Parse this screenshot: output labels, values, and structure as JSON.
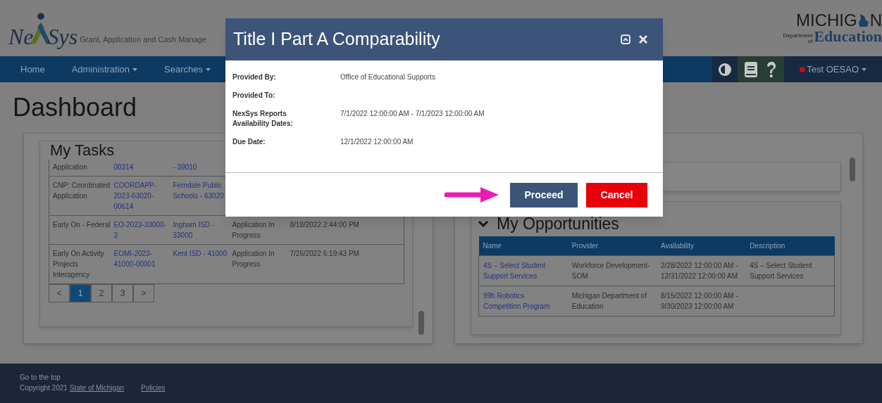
{
  "header": {
    "logo": {
      "left": "Ne",
      "right": "Sys"
    },
    "tagline": "Grant, Application and Cash Manage",
    "state_logo": {
      "top_left": "MICHIG",
      "top_right": "N",
      "small_top": "Department",
      "small_bottom": "of",
      "bottom": "Education"
    }
  },
  "nav": {
    "items": [
      {
        "label": "Home",
        "dropdown": false
      },
      {
        "label": "Administration",
        "dropdown": true
      },
      {
        "label": "Searches",
        "dropdown": true
      }
    ],
    "user": "Test OESAO"
  },
  "page_title": "Dashboard",
  "tasks": {
    "title": "My Tasks",
    "rows": [
      {
        "cells": [
          "Application",
          "00314",
          "- 39010"
        ]
      },
      {
        "cells": [
          "CNP: Coordinated Application",
          "COORDAPP-2023-63020-00614",
          "Ferndale Public Schools - 63020"
        ]
      },
      {
        "cells": [
          "Early On - Federal",
          "EO-2023-33000-3",
          "Ingham ISD - 33000",
          "Application In Progress",
          "8/18/2022 2:44:00 PM"
        ]
      },
      {
        "cells": [
          "Early On Activity Projects Interagency",
          "EOMI-2023-41000-00001",
          "Kent ISD - 41000",
          "Application In Progress",
          "7/26/2022 6:19:43 PM"
        ]
      }
    ],
    "pages": [
      {
        "label": "<",
        "selected": false
      },
      {
        "label": "1",
        "selected": true
      },
      {
        "label": "2",
        "selected": false
      },
      {
        "label": "3",
        "selected": false
      },
      {
        "label": ">",
        "selected": false
      }
    ]
  },
  "opportunities": {
    "title": "My Opportunities",
    "expanded": true,
    "columns": [
      "Name",
      "Provider",
      "Availability",
      "Description"
    ],
    "rows": [
      {
        "cells": [
          "4S – Select Student Support Services",
          "Workforce Development-SOM",
          "2/28/2022 12:00:00 AM - 12/31/2022 12:00:00 AM",
          "4S – Select Student Support Services"
        ]
      },
      {
        "cells": [
          "99h Robotics Competition Program",
          "Michigan Department of Education",
          "8/15/2022 12:00:00 AM - 9/30/2023 12:00:00 AM"
        ]
      }
    ]
  },
  "footer": {
    "top_link": "Go to the top",
    "copyright": "Copyright 2021",
    "state_link": "State of Michigan",
    "policies": "Policies"
  },
  "modal": {
    "title": "Title I Part A Comparability",
    "fields": [
      {
        "label": "Provided By:",
        "value": "Office of Educational Supports"
      },
      {
        "label": "Provided To:"
      },
      {
        "label": "NexSys Reports Availability Dates:",
        "value": "7/1/2022 12:00:00 AM - 7/1/2023 12:00:00 AM"
      },
      {
        "label": "Due Date:",
        "value": "12/1/2022 12:00:00 AM"
      }
    ],
    "buttons": [
      {
        "label": "Proceed",
        "kind": "primary"
      },
      {
        "label": "Cancel",
        "kind": "danger"
      }
    ]
  }
}
